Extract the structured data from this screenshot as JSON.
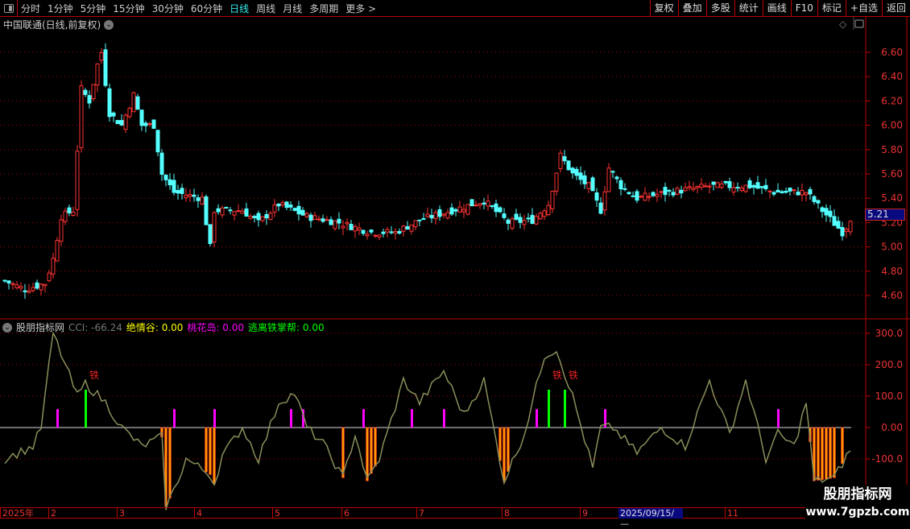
{
  "toolbar": {
    "periods": [
      "分时",
      "1分钟",
      "5分钟",
      "15分钟",
      "30分钟",
      "60分钟",
      "日线",
      "周线",
      "月线",
      "多周期",
      "更多 >"
    ],
    "active": "日线",
    "right": [
      "复权",
      "叠加",
      "多股",
      "统计",
      "画线",
      "F10",
      "标记",
      "+自选",
      "返回"
    ]
  },
  "chart": {
    "title": "中国联通(日线,前复权)",
    "last_price": "5.21",
    "price_ticks": [
      "6.60",
      "6.40",
      "6.20",
      "6.00",
      "5.80",
      "5.60",
      "5.40",
      "5.20",
      "5.00",
      "4.80",
      "4.60"
    ]
  },
  "indicator": {
    "name": "股朋指标网",
    "cci_label": "CCI: -66.24",
    "jqg_label": "绝情谷: 0.00",
    "thd_label": "桃花岛: 0.00",
    "tlz_label": "逃离铁掌帮: 0.00",
    "ticks": [
      "300.0",
      "200.0",
      "100.0",
      "0.00",
      "-100.0"
    ],
    "marker_text": "铁",
    "colors": {
      "cci": "#8a8f5a",
      "jqg": "#ffff00",
      "thd": "#ff00ff",
      "tlz": "#00ff00",
      "orange": "#ff9900"
    }
  },
  "time_axis": {
    "labels": [
      "2025年",
      "2",
      "3",
      "4",
      "5",
      "6",
      "7",
      "8",
      "9",
      "11"
    ],
    "cursor_date": "2025/09/15/—"
  },
  "watermark": {
    "name": "股朋指标网",
    "url": "www.7gpzb.com"
  },
  "chart_data": {
    "type": "candlestick",
    "note": "approximate closes by bar index (0-210)",
    "close_keypoints": [
      [
        0,
        4.72
      ],
      [
        5,
        4.65
      ],
      [
        10,
        4.7
      ],
      [
        12,
        4.9
      ],
      [
        14,
        5.25
      ],
      [
        17,
        5.3
      ],
      [
        18,
        5.8
      ],
      [
        19,
        6.3
      ],
      [
        21,
        6.2
      ],
      [
        23,
        6.5
      ],
      [
        24,
        6.6
      ],
      [
        26,
        6.1
      ],
      [
        29,
        6.0
      ],
      [
        32,
        6.25
      ],
      [
        34,
        6.0
      ],
      [
        37,
        6.0
      ],
      [
        39,
        5.6
      ],
      [
        42,
        5.45
      ],
      [
        49,
        5.4
      ],
      [
        51,
        5.0
      ],
      [
        52,
        5.3
      ],
      [
        59,
        5.3
      ],
      [
        63,
        5.2
      ],
      [
        68,
        5.35
      ],
      [
        75,
        5.25
      ],
      [
        83,
        5.2
      ],
      [
        91,
        5.12
      ],
      [
        97,
        5.12
      ],
      [
        103,
        5.22
      ],
      [
        111,
        5.3
      ],
      [
        119,
        5.38
      ],
      [
        125,
        5.2
      ],
      [
        131,
        5.22
      ],
      [
        135,
        5.35
      ],
      [
        138,
        5.75
      ],
      [
        141,
        5.6
      ],
      [
        145,
        5.5
      ],
      [
        148,
        5.3
      ],
      [
        150,
        5.65
      ],
      [
        153,
        5.5
      ],
      [
        157,
        5.4
      ],
      [
        165,
        5.45
      ],
      [
        175,
        5.5
      ],
      [
        185,
        5.5
      ],
      [
        191,
        5.45
      ],
      [
        199,
        5.45
      ],
      [
        203,
        5.3
      ],
      [
        208,
        5.12
      ],
      [
        210,
        5.21
      ]
    ],
    "cci_keypoints": [
      [
        0,
        -100
      ],
      [
        7,
        -60
      ],
      [
        9,
        0
      ],
      [
        12,
        300
      ],
      [
        15,
        200
      ],
      [
        18,
        100
      ],
      [
        20,
        140
      ],
      [
        25,
        80
      ],
      [
        29,
        0
      ],
      [
        34,
        -60
      ],
      [
        39,
        -30
      ],
      [
        40,
        -250
      ],
      [
        42,
        -200
      ],
      [
        45,
        -100
      ],
      [
        51,
        -150
      ],
      [
        52,
        -180
      ],
      [
        54,
        -90
      ],
      [
        59,
        0
      ],
      [
        63,
        -100
      ],
      [
        68,
        80
      ],
      [
        72,
        110
      ],
      [
        75,
        0
      ],
      [
        79,
        -50
      ],
      [
        84,
        -160
      ],
      [
        87,
        -20
      ],
      [
        90,
        -170
      ],
      [
        93,
        -100
      ],
      [
        99,
        150
      ],
      [
        103,
        80
      ],
      [
        109,
        180
      ],
      [
        114,
        40
      ],
      [
        119,
        150
      ],
      [
        124,
        -170
      ],
      [
        129,
        -20
      ],
      [
        134,
        230
      ],
      [
        137,
        250
      ],
      [
        141,
        100
      ],
      [
        146,
        -130
      ],
      [
        148,
        0
      ],
      [
        151,
        0
      ],
      [
        157,
        -80
      ],
      [
        163,
        0
      ],
      [
        169,
        -60
      ],
      [
        175,
        150
      ],
      [
        180,
        -20
      ],
      [
        184,
        150
      ],
      [
        189,
        -100
      ],
      [
        192,
        -20
      ],
      [
        196,
        -60
      ],
      [
        199,
        80
      ],
      [
        201,
        -170
      ],
      [
        206,
        -160
      ],
      [
        210,
        -70
      ]
    ],
    "thd_bars": [
      13,
      42,
      52,
      71,
      74,
      89,
      101,
      109,
      132,
      149,
      192
    ],
    "tlz_bars": [
      20,
      135,
      139
    ],
    "jqg_bars": [
      39,
      40,
      41,
      50,
      51,
      52,
      84,
      90,
      91,
      92,
      123,
      124,
      125,
      200,
      201,
      202,
      203,
      204,
      205,
      206,
      208
    ],
    "marker_bars": [
      21,
      136,
      140
    ]
  }
}
